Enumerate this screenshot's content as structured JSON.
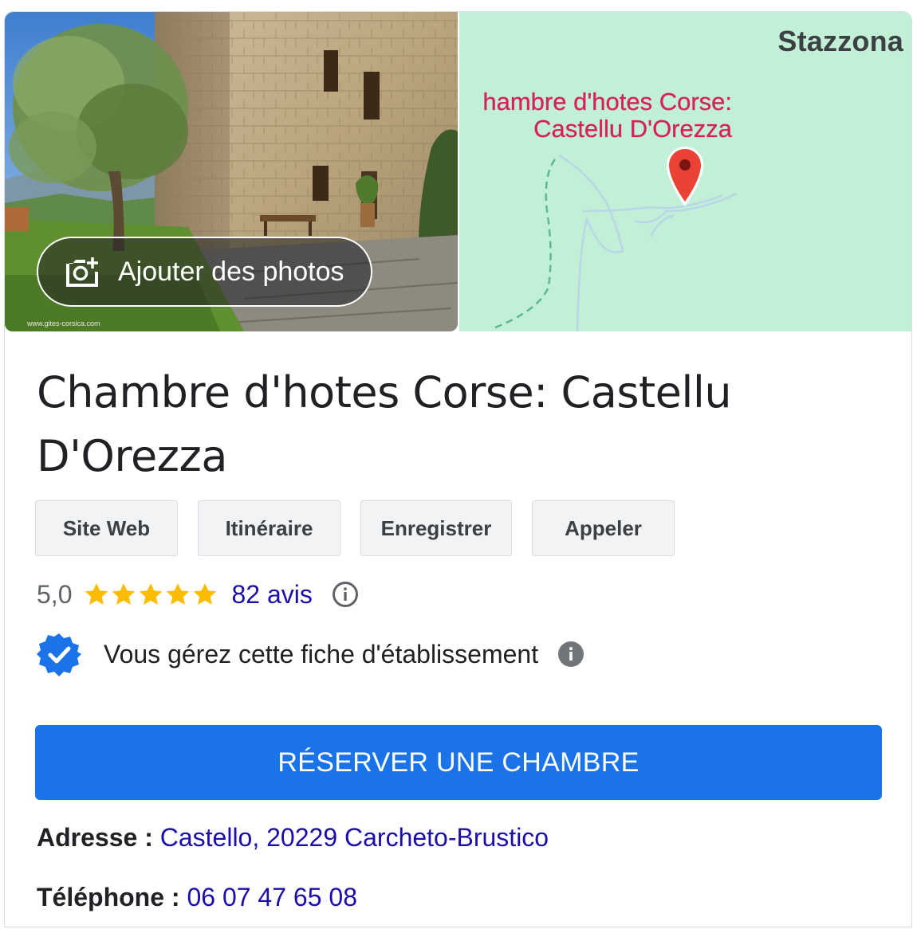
{
  "photo_button": {
    "label": "Ajouter des photos",
    "icon": "add-photo-icon"
  },
  "map": {
    "town_label": "Stazzona",
    "place_label_line1": "hambre d'hotes Corse:",
    "place_label_line2": "Castellu D'Orezza",
    "pin_icon": "map-pin-icon",
    "pin_color": "#ea4335",
    "label_color": "#d5225d",
    "background_color": "#c2f0d7"
  },
  "title": {
    "line1": "Chambre d'hotes Corse: Castellu",
    "line2": "D'Orezza"
  },
  "actions": [
    "Site Web",
    "Itinéraire",
    "Enregistrer",
    "Appeler"
  ],
  "rating": {
    "value": "5,0",
    "stars": 5,
    "star_color": "#fbbc04",
    "reviews_label": "82 avis",
    "info_icon": "info-outline-icon"
  },
  "managed": {
    "text": "Vous gérez cette fiche d'établissement",
    "badge_icon": "verified-badge-icon",
    "badge_color": "#1a73e8",
    "info_icon": "info-filled-icon"
  },
  "book_button": {
    "label": "RÉSERVER UNE CHAMBRE",
    "color": "#1a73e8"
  },
  "address": {
    "label": "Adresse : ",
    "value": "Castello, 20229 Carcheto-Brustico"
  },
  "phone": {
    "label": "Téléphone : ",
    "value": "06 07 47 65 08"
  },
  "link_color": "#1a0dab"
}
